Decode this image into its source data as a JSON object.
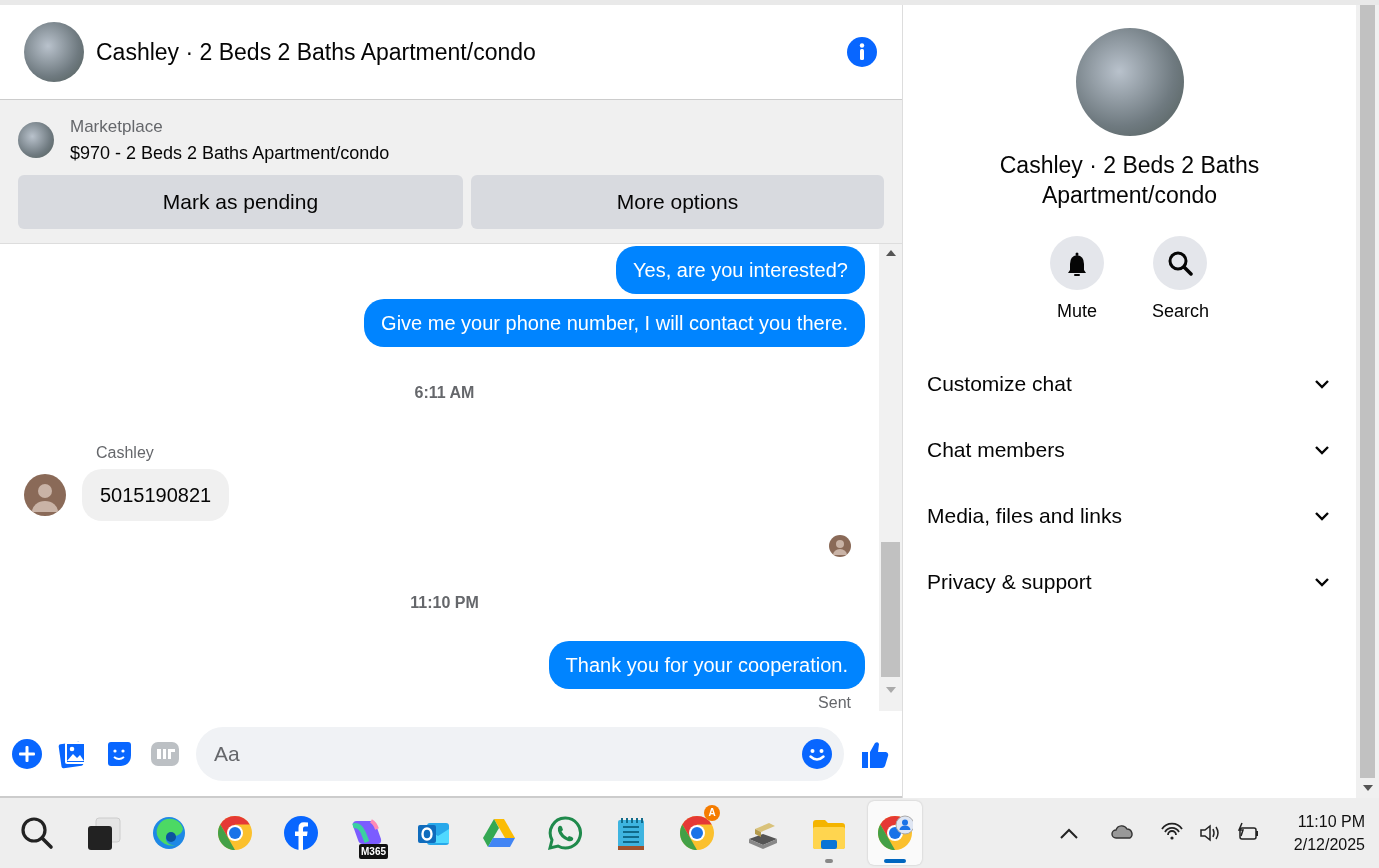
{
  "header": {
    "title": "Cashley · 2 Beds 2 Baths Apartment/condo"
  },
  "listing": {
    "source": "Marketplace",
    "summary": "$970 - 2 Beds 2 Baths Apartment/condo",
    "buttons": [
      "Mark as pending",
      "More options"
    ]
  },
  "messages": [
    {
      "kind": "outgoing",
      "text": "Yes, are you interested?"
    },
    {
      "kind": "outgoing",
      "text": "Give me your phone number, I will contact you there."
    },
    {
      "kind": "time",
      "text": "6:11 AM"
    },
    {
      "kind": "sender",
      "text": "Cashley"
    },
    {
      "kind": "incoming",
      "text": "5015190821"
    },
    {
      "kind": "seen"
    },
    {
      "kind": "time",
      "text": "11:10 PM"
    },
    {
      "kind": "outgoing",
      "text": "Thank you for your cooperation."
    },
    {
      "kind": "status",
      "text": "Sent"
    }
  ],
  "composer": {
    "placeholder": "Aa"
  },
  "details": {
    "title": "Cashley · 2 Beds 2 Baths Apartment/condo",
    "actions": [
      {
        "kind": "mute",
        "label": "Mute"
      },
      {
        "kind": "search",
        "label": "Search"
      }
    ],
    "sections": [
      {
        "label": "Customize chat",
        "expanded": false
      },
      {
        "label": "Chat members",
        "expanded": false
      },
      {
        "label": "Media, files and links",
        "expanded": false
      },
      {
        "label": "Privacy & support",
        "expanded": false
      }
    ]
  },
  "taskbar": {
    "apps": [
      {
        "kind": "search",
        "selected": false,
        "running": false
      },
      {
        "kind": "taskview",
        "selected": false,
        "running": false
      },
      {
        "kind": "edge",
        "selected": false,
        "running": false
      },
      {
        "kind": "chrome",
        "selected": false,
        "running": false
      },
      {
        "kind": "facebook",
        "selected": false,
        "running": false
      },
      {
        "kind": "copilot",
        "badge": "M365",
        "selected": false,
        "running": false
      },
      {
        "kind": "outlook",
        "selected": false,
        "running": false
      },
      {
        "kind": "drive",
        "selected": false,
        "running": false
      },
      {
        "kind": "whatsapp",
        "selected": false,
        "running": false
      },
      {
        "kind": "notepad",
        "selected": false,
        "running": false
      },
      {
        "kind": "chrome",
        "badge": "A",
        "selected": false,
        "running": false
      },
      {
        "kind": "drive-tool",
        "selected": false,
        "running": false
      },
      {
        "kind": "folder",
        "selected": false,
        "running": true
      },
      {
        "kind": "chrome-profile",
        "selected": true
      }
    ],
    "clock": {
      "time": "11:10 PM",
      "date": "2/12/2025"
    }
  }
}
